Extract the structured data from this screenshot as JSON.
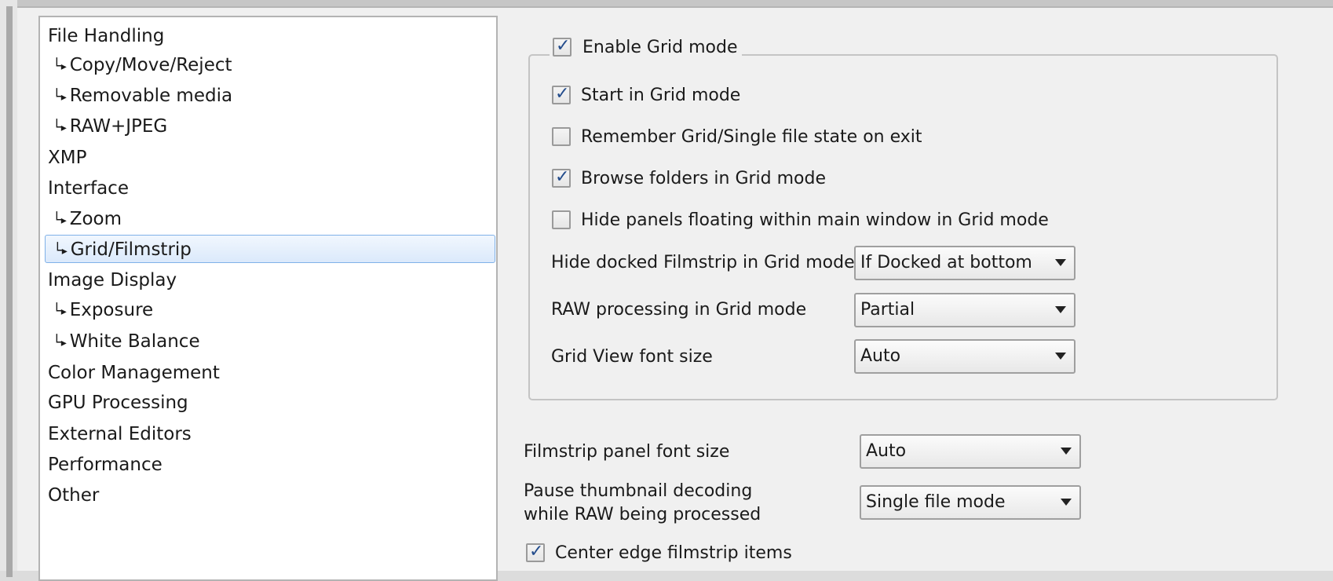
{
  "sidebar": {
    "items": [
      {
        "label": "File Handling",
        "child": false,
        "selected": false
      },
      {
        "label": "Copy/Move/Reject",
        "child": true,
        "selected": false
      },
      {
        "label": "Removable media",
        "child": true,
        "selected": false
      },
      {
        "label": "RAW+JPEG",
        "child": true,
        "selected": false
      },
      {
        "label": "XMP",
        "child": false,
        "selected": false
      },
      {
        "label": "Interface",
        "child": false,
        "selected": false
      },
      {
        "label": "Zoom",
        "child": true,
        "selected": false
      },
      {
        "label": "Grid/Filmstrip",
        "child": true,
        "selected": true
      },
      {
        "label": "Image Display",
        "child": false,
        "selected": false
      },
      {
        "label": "Exposure",
        "child": true,
        "selected": false
      },
      {
        "label": "White Balance",
        "child": true,
        "selected": false
      },
      {
        "label": "Color Management",
        "child": false,
        "selected": false
      },
      {
        "label": "GPU Processing",
        "child": false,
        "selected": false
      },
      {
        "label": "External Editors",
        "child": false,
        "selected": false
      },
      {
        "label": "Performance",
        "child": false,
        "selected": false
      },
      {
        "label": "Other",
        "child": false,
        "selected": false
      }
    ],
    "child_arrow": "└▸"
  },
  "grid_group": {
    "enable_label": "Enable Grid mode",
    "enable_checked": true,
    "start_label": "Start in Grid mode",
    "start_checked": true,
    "remember_label": "Remember Grid/Single file state on exit",
    "remember_checked": false,
    "browse_label": "Browse folders in Grid mode",
    "browse_checked": true,
    "hide_panels_label": "Hide panels floating within main window in Grid mode",
    "hide_panels_checked": false,
    "hide_filmstrip_label": "Hide docked Filmstrip in Grid mode",
    "hide_filmstrip_value": "If Docked at bottom",
    "raw_label": "RAW processing in Grid mode",
    "raw_value": "Partial",
    "font_label": "Grid View font size",
    "font_value": "Auto"
  },
  "filmstrip": {
    "font_label": "Filmstrip panel font size",
    "font_value": "Auto",
    "pause_label_line1": "Pause thumbnail decoding",
    "pause_label_line2": "while RAW being processed",
    "pause_value": "Single file mode",
    "center_label": "Center edge filmstrip items",
    "center_checked": true
  }
}
